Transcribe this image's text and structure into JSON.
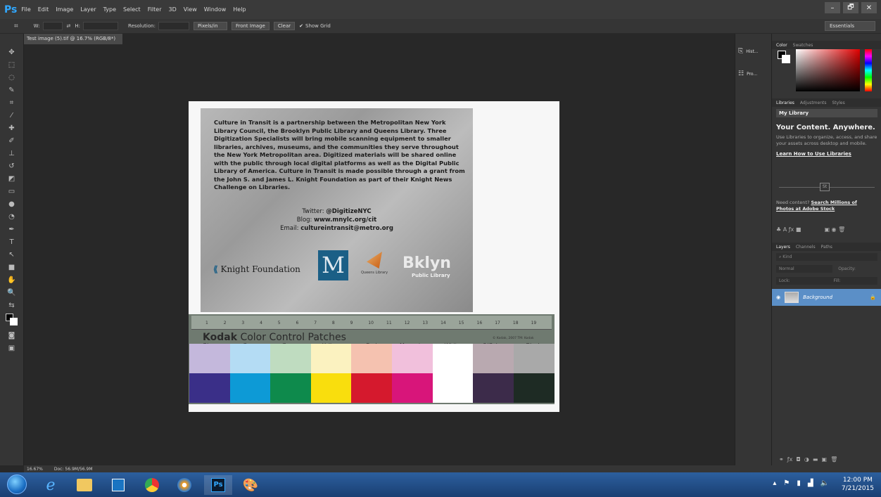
{
  "app": {
    "logo": "Ps",
    "menus": [
      "File",
      "Edit",
      "Image",
      "Layer",
      "Type",
      "Select",
      "Filter",
      "3D",
      "View",
      "Window",
      "Help"
    ]
  },
  "window_controls": [
    "–",
    "🗗",
    "✕"
  ],
  "options": {
    "w_label": "W:",
    "h_label": "H:",
    "resolution_label": "Resolution:",
    "units": "Pixels/in",
    "front_image": "Front Image",
    "clear": "Clear",
    "show_grid": "Show Grid",
    "workspace": "Essentials"
  },
  "document": {
    "tab_title": "Test image (5).tif @ 16.7% (RGB/8*)",
    "zoom": "16.67%",
    "doc_size": "Doc: 56.9M/56.9M"
  },
  "scan": {
    "paragraph": "Culture in Transit is a partnership between the Metropolitan New York Library Council, the Brooklyn Public Library and Queens Library. Three Digitization Specialists will bring mobile scanning equipment to smaller libraries, archives, museums, and the communities they serve throughout the New York Metropolitan area. Digitized materials will be shared online with the public through local digital platforms as well as the Digital Public Library of America. Culture in Transit is made possible through a grant from the John S. and James L. Knight Foundation as part of their Knight News Challenge on Libraries.",
    "twitter_label": "Twitter:",
    "twitter": "@DigitizeNYC",
    "blog_label": "Blog:",
    "blog": "www.mnylc.org/cit",
    "email_label": "Email:",
    "email": "cultureintransit@metro.org",
    "knight": "Knight Foundation",
    "m_logo": "M",
    "queens": "Queens Library",
    "bklyn": "Bklyn",
    "bklyn_sub": "Public Library"
  },
  "kodak": {
    "brand": "Kodak",
    "title": "Color Control Patches",
    "copyright": "© Kodak, 2007 TM: Kodak",
    "ruler_numbers": [
      "1",
      "2",
      "3",
      "4",
      "5",
      "6",
      "7",
      "8",
      "9",
      "10",
      "11",
      "12",
      "13",
      "14",
      "15",
      "16",
      "17",
      "18",
      "19"
    ],
    "patches": [
      {
        "name": "Blue",
        "light": "#c4b8dc",
        "dark": "#3a2f88"
      },
      {
        "name": "Cyan",
        "light": "#b4dcf4",
        "dark": "#0d9ad6"
      },
      {
        "name": "Green",
        "light": "#bfdcc0",
        "dark": "#0e8a4c"
      },
      {
        "name": "Yellow",
        "light": "#fbf2c0",
        "dark": "#f9de0d"
      },
      {
        "name": "Red",
        "light": "#f5c2b0",
        "dark": "#d5192d"
      },
      {
        "name": "Magenta",
        "light": "#f1c0dc",
        "dark": "#d8157a"
      },
      {
        "name": "White",
        "light": "#ffffff",
        "dark": "#ffffff"
      },
      {
        "name": "3/Color",
        "light": "#b9a9b0",
        "dark": "#3c2b4a"
      },
      {
        "name": "Black",
        "light": "#a9a9a9",
        "dark": "#1e2b24"
      }
    ]
  },
  "mini_panels": [
    "Hist...",
    "Pro..."
  ],
  "color_panel": {
    "tabs": [
      "Color",
      "Swatches"
    ]
  },
  "libraries_panel": {
    "tabs": [
      "Libraries",
      "Adjustments",
      "Styles"
    ],
    "library": "My Library",
    "heading": "Your Content. Anywhere.",
    "desc": "Use Libraries to organize, access, and share your assets across desktop and mobile.",
    "learn": "Learn How to Use Libraries",
    "stock_lead": "Need content?",
    "stock_link": "Search Millions of Photos at Adobe Stock"
  },
  "layers_panel": {
    "tabs": [
      "Layers",
      "Channels",
      "Paths"
    ],
    "kind": "Kind",
    "blend": "Normal",
    "opacity": "Opacity:",
    "lock": "Lock:",
    "fill": "Fill:",
    "layer_name": "Background"
  },
  "taskbar": {
    "time": "12:00 PM",
    "date": "7/21/2015"
  }
}
